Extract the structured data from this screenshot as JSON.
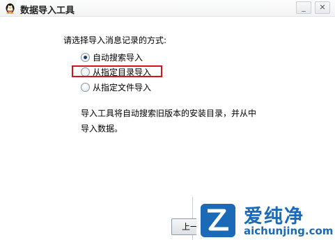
{
  "window": {
    "title": "数据导入工具",
    "minimize_label": "_",
    "close_label": "✕"
  },
  "content": {
    "prompt": "请选择导入消息记录的方式:",
    "options": [
      {
        "label": "自动搜索导入",
        "checked": true
      },
      {
        "label": "从指定目录导入",
        "checked": false
      },
      {
        "label": "从指定文件导入",
        "checked": false
      }
    ],
    "description_line1": "导入工具将自动搜索旧版本的安装目录，并从中",
    "description_line2": "导入数据。"
  },
  "buttons": {
    "prev_label": "上一"
  },
  "watermark": {
    "title": "爱纯净",
    "url": "aichunjing.com"
  },
  "colors": {
    "highlight": "#d4141c",
    "brand": "#1a6ab8"
  }
}
